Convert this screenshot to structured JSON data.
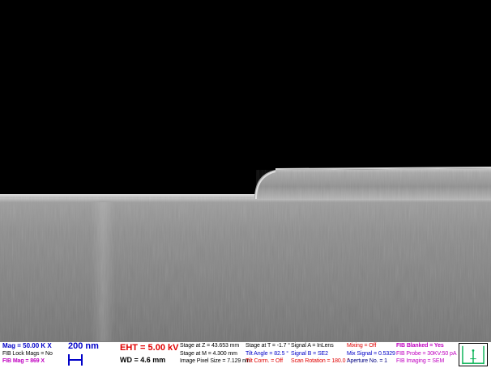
{
  "colors": {
    "background": "#000000",
    "label_blue": "#0000c8",
    "label_navy": "#000080",
    "label_red": "#e00000",
    "label_magenta": "#c000c0",
    "indicator_green": "#00b050"
  },
  "databar": {
    "col1": {
      "mag": "Mag =   50.00 K X",
      "fib_lock": "FIB Lock Mags = No",
      "fib_mag": "FIB Mag =   869 X"
    },
    "scalebar_label": "200 nm",
    "eht": "EHT = 5.00 kV",
    "wd": "WD = 4.6 mm",
    "col3": {
      "stage_z": "Stage at Z = 43.653 mm",
      "stage_m": "Stage at M =  4.300 mm",
      "pixel_size": "Image Pixel Size = 7.129 nm"
    },
    "col4": {
      "stage_t": "Stage at T =  -1.7 °",
      "tilt_angle": "Tilt Angle =  82.5 °",
      "tilt_corrn": "Tilt Corrn. = Off"
    },
    "col5": {
      "signal_a": "Signal A = InLens",
      "signal_b": "Signal B = SE2",
      "scan_rotation": "Scan Rotation = 180.0 °"
    },
    "col6": {
      "mixing": "Mixing = Off",
      "mix_signal": "Mix Signal = 0.5329",
      "aperture": "Aperture No. = 1"
    },
    "col7": {
      "fib_blanked": "FIB Blanked = Yes",
      "fib_probe": "FIB Probe = 30KV:50 pA",
      "fib_imaging": "FIB Imaging = SEM"
    },
    "indicator_icon": "tilt-indicator-icon"
  }
}
